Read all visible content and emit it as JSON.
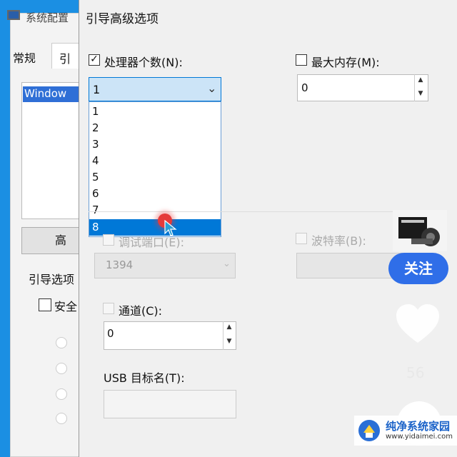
{
  "background_window": {
    "title": "系统配置",
    "tabs": [
      "常规",
      "引"
    ],
    "boot_list_item": "Window",
    "advanced_button_label": "高",
    "boot_options_label": "引导选项",
    "safe_boot_label": "安全"
  },
  "dialog": {
    "title": "引导高级选项",
    "num_processors": {
      "checked": true,
      "label": "处理器个数(N):",
      "value": "1",
      "options": [
        "1",
        "2",
        "3",
        "4",
        "5",
        "6",
        "7",
        "8"
      ],
      "highlighted": "8"
    },
    "max_memory": {
      "checked": false,
      "label": "最大内存(M):",
      "value": "0"
    },
    "debug_port": {
      "label": "调试端口(E):",
      "value": "1394"
    },
    "baud_rate": {
      "label": "波特率(B):"
    },
    "channel": {
      "label": "通道(C):",
      "value": "0"
    },
    "usb_target": {
      "label": "USB 目标名(T):",
      "value": ""
    }
  },
  "overlay": {
    "follow_button": "关注",
    "like_label": "56",
    "watermark_name": "纯净系统家园",
    "watermark_url": "www.yidaimei.com"
  },
  "colors": {
    "selection": "#0078d7",
    "follow": "#2f6ee8",
    "desktop": "#1b8fe3"
  },
  "icons": {
    "checkbox_checked": "check-icon",
    "chevron": "chevron-down-icon",
    "spin_up": "spin-up-icon",
    "spin_down": "spin-down-icon",
    "heart": "heart-icon",
    "cursor": "pointer-cursor-icon"
  }
}
